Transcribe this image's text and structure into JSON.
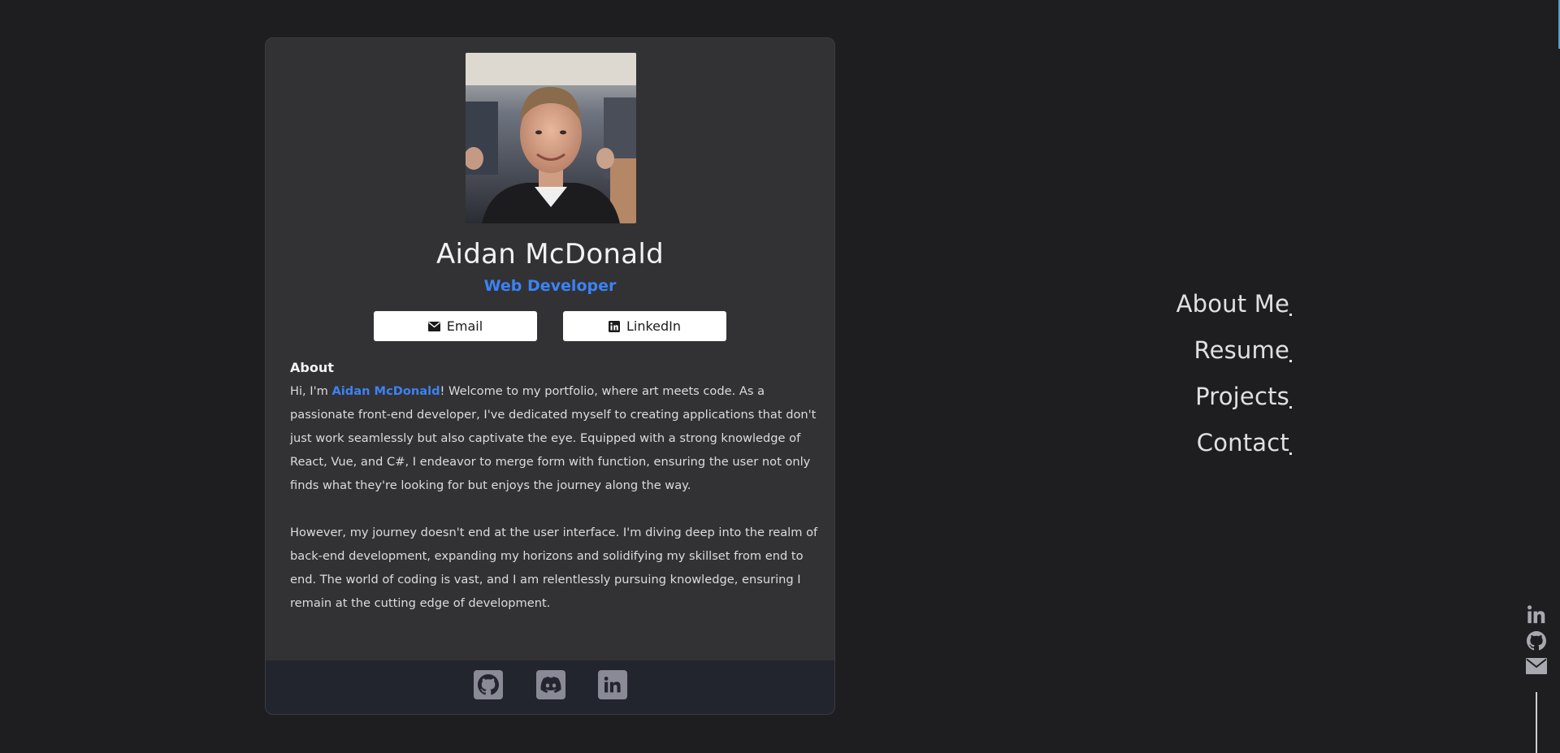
{
  "profile": {
    "name": "Aidan McDonald",
    "role": "Web Developer"
  },
  "buttons": {
    "email_label": "Email",
    "linkedin_label": "LinkedIn"
  },
  "about": {
    "heading": "About",
    "p1_prefix": "Hi, I'm ",
    "p1_name": "Aidan McDonald",
    "p1_rest": "! Welcome to my portfolio, where art meets code. As a passionate front-end developer, I've dedicated myself to creating applications that don't just work seamlessly but also captivate the eye. Equipped with a strong knowledge of React, Vue, and C#, I endeavor to merge form with function, ensuring the user not only finds what they're looking for but enjoys the journey along the way.",
    "p2": "However, my journey doesn't end at the user interface. I'm diving deep into the realm of back-end development, expanding my horizons and solidifying my skillset from end to end. The world of coding is vast, and I am relentlessly pursuing knowledge, ensuring I remain at the cutting edge of development."
  },
  "footer_icons": [
    "github-icon",
    "discord-icon",
    "linkedin-icon"
  ],
  "nav": {
    "items": [
      {
        "label": "About Me"
      },
      {
        "label": "Resume"
      },
      {
        "label": "Projects"
      },
      {
        "label": "Contact"
      }
    ]
  },
  "side_social_icons": [
    "linkedin-icon",
    "github-icon",
    "email-icon"
  ],
  "colors": {
    "background": "#1e1e20",
    "card": "#323234",
    "accent": "#3b82f6",
    "footer": "#23252e"
  }
}
